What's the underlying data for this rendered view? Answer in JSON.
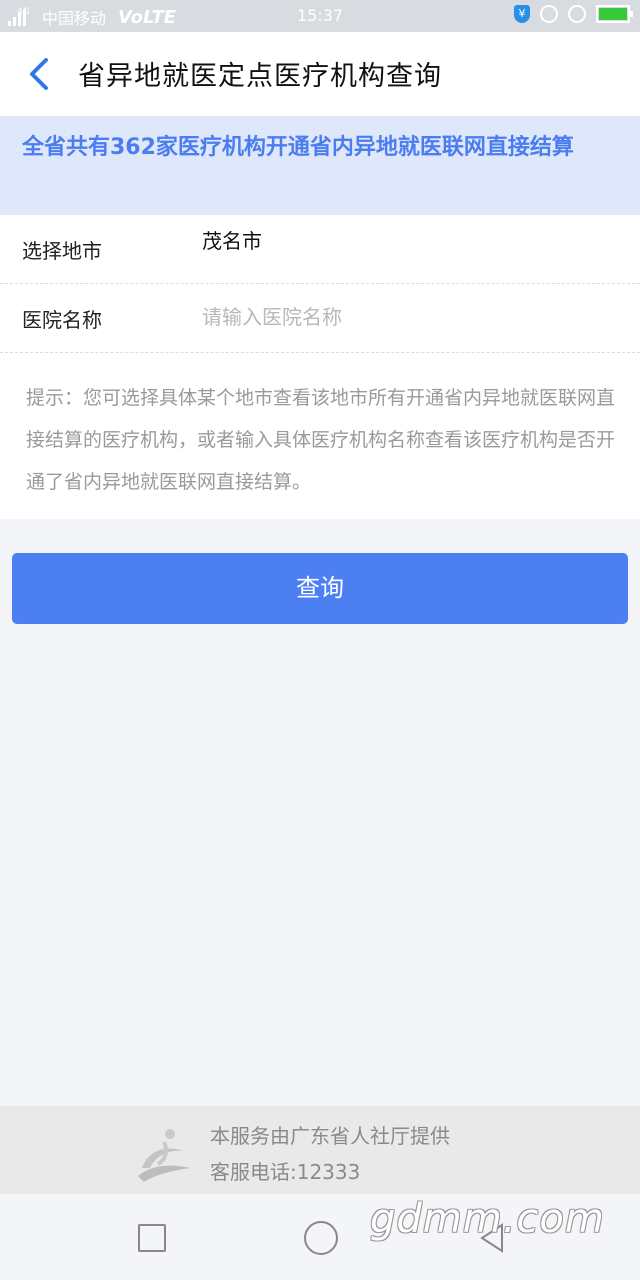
{
  "status_bar": {
    "network": "4G",
    "carrier": "中国移动",
    "volte": "VoLTE",
    "time": "15:37",
    "icons": [
      "signal-icon",
      "shield-yen-icon",
      "lock-rotation-icon",
      "alarm-icon",
      "battery-charging-icon"
    ]
  },
  "header": {
    "back_icon": "chevron-left-icon",
    "title": "省异地就医定点医疗机构查询"
  },
  "notice": {
    "text": "全省共有362家医疗机构开通省内异地就医联网直接结算"
  },
  "form": {
    "city_label": "选择地市",
    "city_value": "茂名市",
    "hospital_label": "医院名称",
    "hospital_value": "",
    "hospital_placeholder": "请输入医院名称",
    "hint": "提示：您可选择具体某个地市查看该地市所有开通省内异地就医联网直接结算的医疗机构，或者输入具体医疗机构名称查看该医疗机构是否开通了省内异地就医联网直接结算。"
  },
  "query_button": {
    "label": "查询"
  },
  "footer": {
    "provider": "本服务由广东省人社厅提供",
    "hotline": "客服电话:12333"
  },
  "nav": {
    "icons": [
      "recent-apps-icon",
      "home-icon",
      "back-icon"
    ]
  },
  "watermark": "gdmm.com",
  "colors": {
    "accent": "#4b7ff2",
    "notice_bg": "#dfe8fb",
    "notice_text": "#4b7df0",
    "page_bg": "#f3f4f8"
  }
}
